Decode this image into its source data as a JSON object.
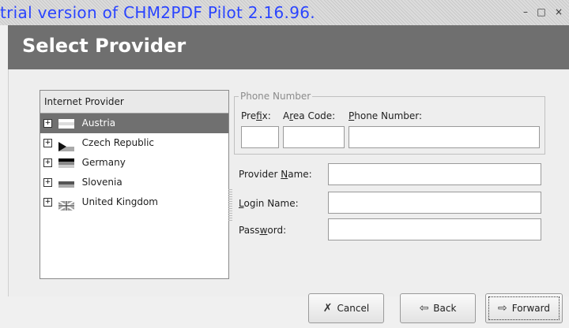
{
  "window": {
    "watermark": "trial version of CHM2PDF Pilot 2.16.96.",
    "controls": {
      "minimize": "–",
      "maximize": "□",
      "close": "×"
    }
  },
  "header": {
    "title": "Select Provider"
  },
  "tree": {
    "header": "Internet Provider",
    "items": [
      {
        "label": "Austria",
        "flag": "austria-flag",
        "selected": true
      },
      {
        "label": "Czech Republic",
        "flag": "czech-flag",
        "selected": false
      },
      {
        "label": "Germany",
        "flag": "germany-flag",
        "selected": false
      },
      {
        "label": "Slovenia",
        "flag": "slovenia-flag",
        "selected": false
      },
      {
        "label": "United Kingdom",
        "flag": "uk-flag",
        "selected": false
      }
    ]
  },
  "phone": {
    "legend": "Phone Number",
    "prefix_label": "Prefix:",
    "area_label": "Area Code:",
    "number_label": "Phone Number:",
    "prefix_value": "",
    "area_value": "",
    "number_value": ""
  },
  "provider_name": {
    "label": "Provider Name:",
    "value": ""
  },
  "login_name": {
    "label": "Login Name:",
    "value": ""
  },
  "password": {
    "label": "Password:",
    "value": ""
  },
  "buttons": {
    "cancel": "Cancel",
    "back": "Back",
    "forward": "Forward"
  },
  "icons": {
    "cancel": "x-mark-icon",
    "back": "arrow-left-icon",
    "forward": "arrow-right-icon"
  }
}
